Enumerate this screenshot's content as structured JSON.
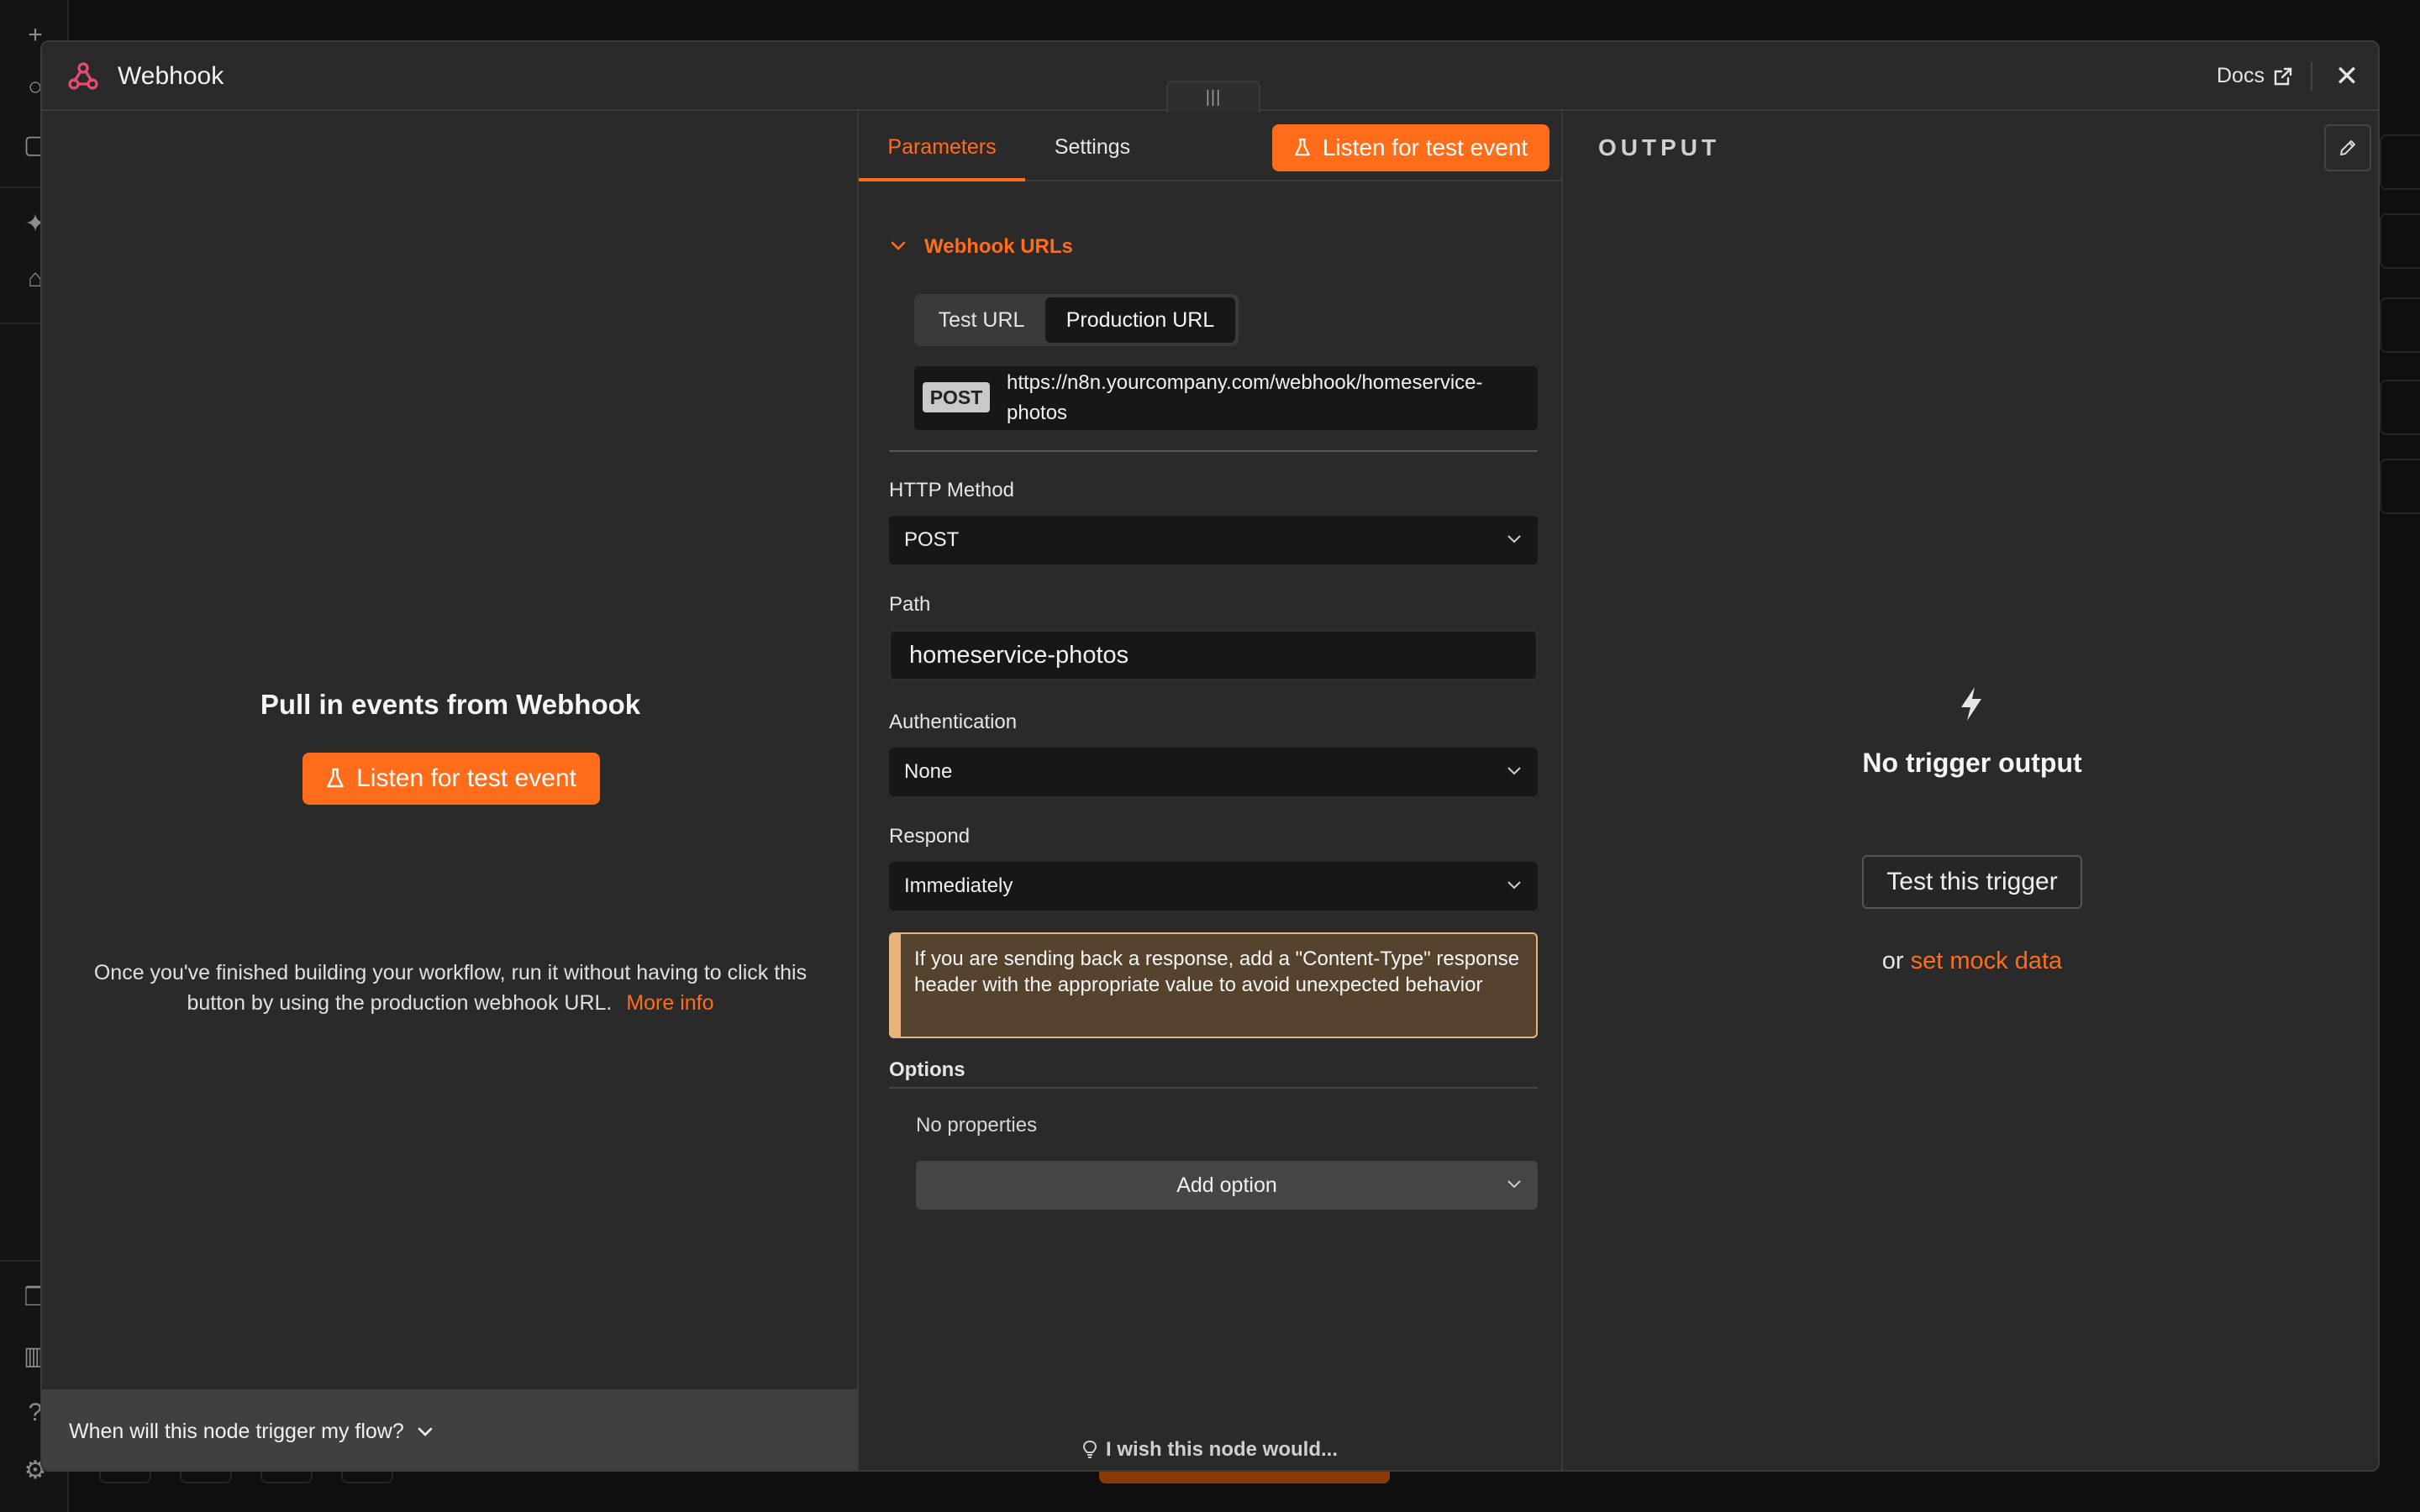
{
  "modal": {
    "title": "Webhook",
    "docs_label": "Docs",
    "close_label": "✕",
    "drag_handle": "|||"
  },
  "left": {
    "heading": "Pull in events from Webhook",
    "listen_label": "Listen for test event",
    "info_text": "Once you've finished building your workflow, run it without having to click this button by using the production webhook URL.",
    "more_info": "More info",
    "footer_label": "When will this node trigger my flow?"
  },
  "middle": {
    "tabs": [
      {
        "label": "Parameters",
        "active": true
      },
      {
        "label": "Settings",
        "active": false
      }
    ],
    "listen_label": "Listen for test event",
    "webhook_urls": {
      "title": "Webhook URLs",
      "toggle": [
        "Test URL",
        "Production URL"
      ],
      "selected": "Production URL",
      "method_badge": "POST",
      "url": "https://n8n.yourcompany.com/webhook/homeservice-photos"
    },
    "http_method": {
      "label": "HTTP Method",
      "value": "POST"
    },
    "path": {
      "label": "Path",
      "value": "homeservice-photos"
    },
    "authentication": {
      "label": "Authentication",
      "value": "None"
    },
    "respond": {
      "label": "Respond",
      "value": "Immediately"
    },
    "notice": "If you are sending back a response, add a \"Content-Type\" response header with the appropriate value to avoid unexpected behavior",
    "options": {
      "label": "Options",
      "empty_text": "No properties",
      "add_label": "Add option"
    },
    "wish_label": "I wish this node would..."
  },
  "right": {
    "output_label": "OUTPUT",
    "no_output": "No trigger output",
    "test_label": "Test this trigger",
    "or_text": "or",
    "mock_link": "set mock data"
  },
  "colors": {
    "accent": "#ff6d1a",
    "panel": "#2a2a2a",
    "input_bg": "#171717",
    "notice_bg": "#55432d",
    "notice_border": "#e8b47e",
    "logo": "#ea4b71"
  }
}
